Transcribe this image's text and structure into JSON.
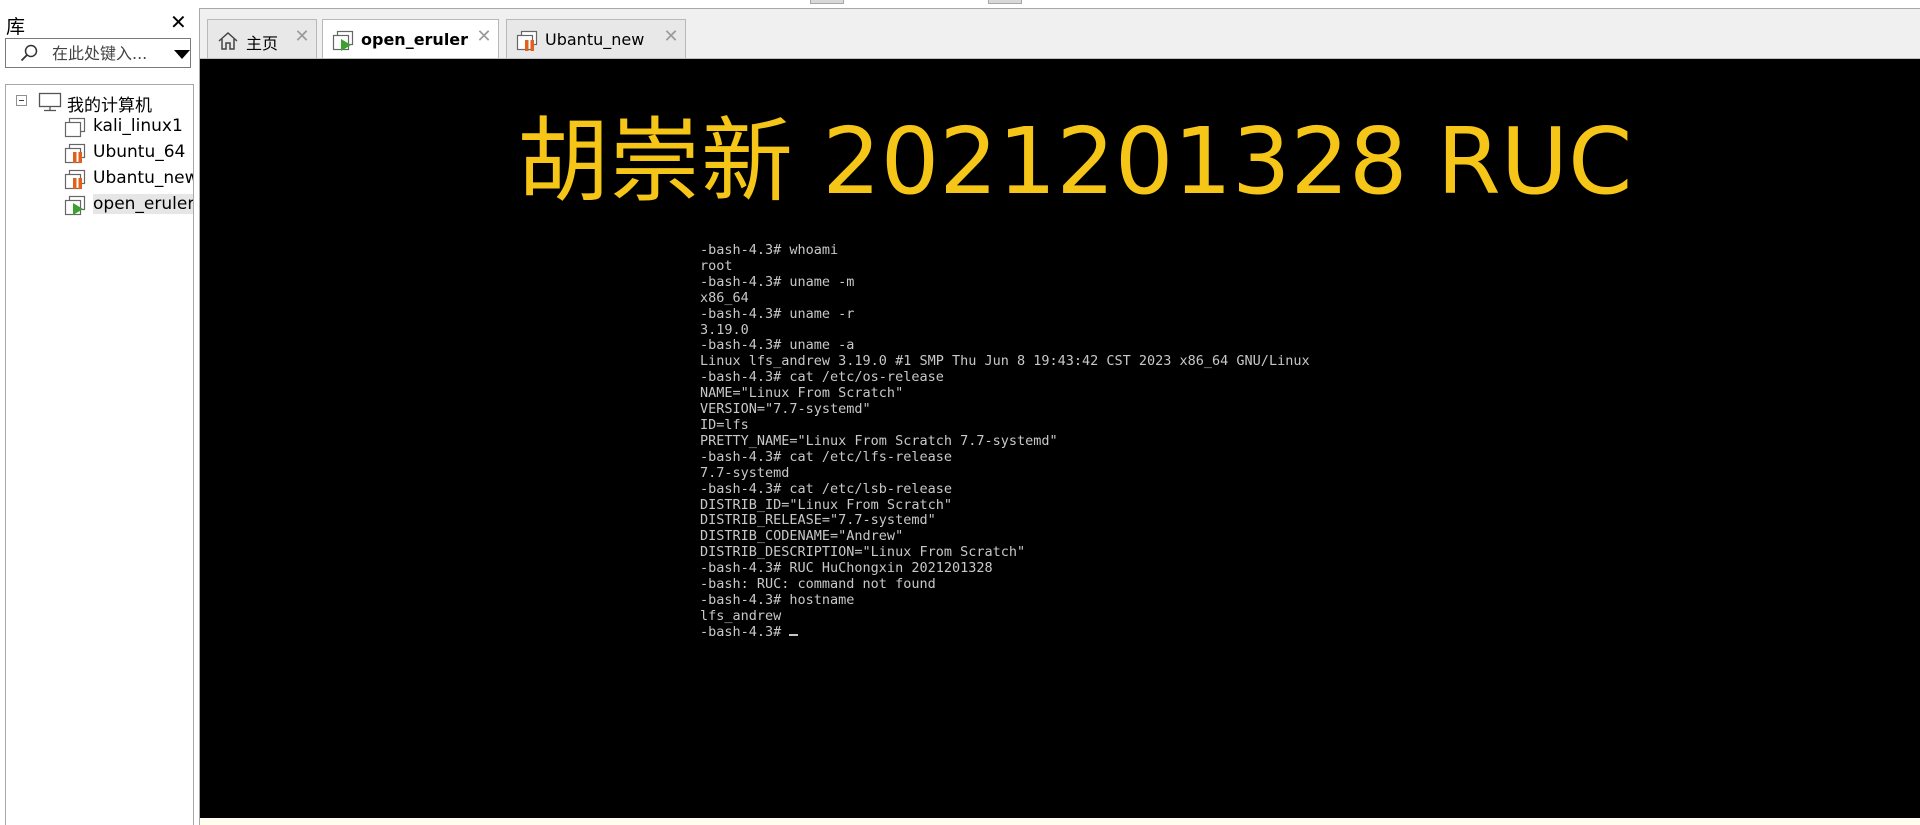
{
  "library": {
    "title": "库",
    "close_glyph": "✕",
    "search": {
      "placeholder": "在此处键入..."
    },
    "tree": {
      "root": {
        "label": "我的计算机",
        "icon": "computer-icon"
      },
      "items": [
        {
          "label": "kali_linux1",
          "icon": "vm-icon"
        },
        {
          "label": "Ubuntu_64",
          "icon": "vm-suspended-icon"
        },
        {
          "label": "Ubantu_new",
          "icon": "vm-suspended-icon"
        },
        {
          "label": "open_eruler",
          "icon": "vm-running-icon",
          "selected": true
        }
      ]
    }
  },
  "tabs": [
    {
      "label": "主页",
      "icon": "home-icon",
      "active": false
    },
    {
      "label": "open_eruler",
      "icon": "vm-running-icon",
      "active": true
    },
    {
      "label": "Ubantu_new",
      "icon": "vm-suspended-icon",
      "active": false
    }
  ],
  "tab_close_glyph": "✕",
  "console": {
    "overlay_title": "胡崇新 2021201328 RUC",
    "lines": [
      "-bash-4.3# whoami",
      "root",
      "-bash-4.3# uname -m",
      "x86_64",
      "-bash-4.3# uname -r",
      "3.19.0",
      "-bash-4.3# uname -a",
      "Linux lfs_andrew 3.19.0 #1 SMP Thu Jun 8 19:43:42 CST 2023 x86_64 GNU/Linux",
      "-bash-4.3# cat /etc/os-release",
      "NAME=\"Linux From Scratch\"",
      "VERSION=\"7.7-systemd\"",
      "ID=lfs",
      "PRETTY_NAME=\"Linux From Scratch 7.7-systemd\"",
      "-bash-4.3# cat /etc/lfs-release",
      "7.7-systemd",
      "-bash-4.3# cat /etc/lsb-release",
      "DISTRIB_ID=\"Linux From Scratch\"",
      "DISTRIB_RELEASE=\"7.7-systemd\"",
      "DISTRIB_CODENAME=\"Andrew\"",
      "DISTRIB_DESCRIPTION=\"Linux From Scratch\"",
      "-bash-4.3# RUC HuChongxin 2021201328",
      "-bash: RUC: command not found",
      "-bash-4.3# hostname",
      "lfs_andrew",
      "-bash-4.3# "
    ]
  },
  "colors": {
    "overlay_text": "#f5c518",
    "console_bg": "#000000",
    "console_fg": "#c8c8c8",
    "running_green": "#3aa02e",
    "suspended_orange": "#e0601c"
  }
}
